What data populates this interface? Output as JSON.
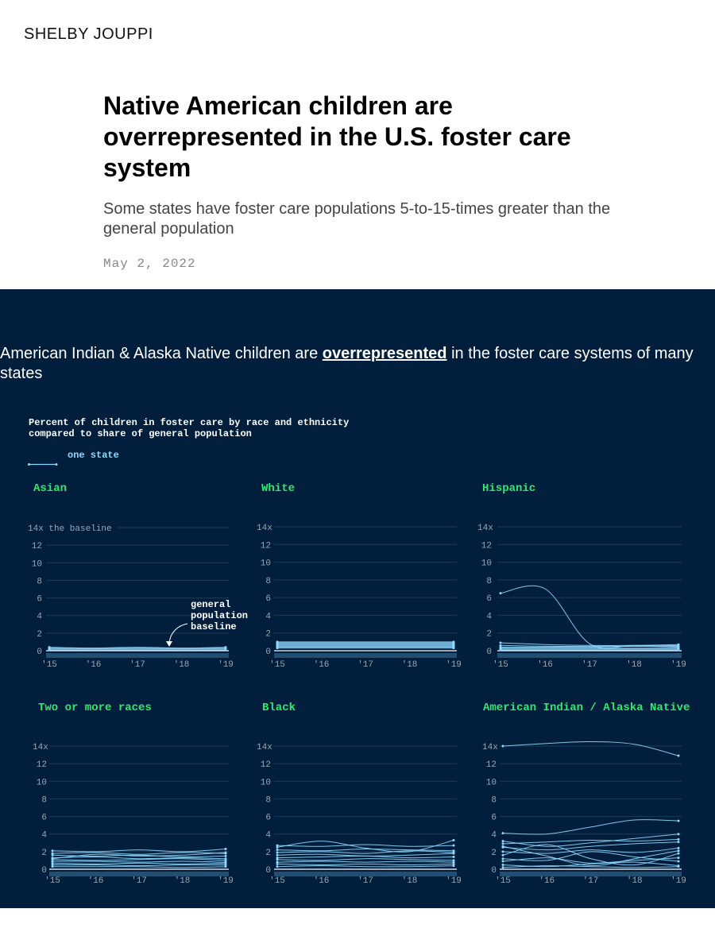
{
  "site": {
    "name": "SHELBY JOUPPI"
  },
  "article": {
    "title": "Native American children are overrepresented in the U.S. foster care system",
    "subtitle": "Some states have foster care populations 5-to-15-times greater than the general population",
    "date": "May 2, 2022"
  },
  "section": {
    "headline_pre": "American Indian & Alaska Native children are ",
    "headline_highlight": "overrepresented",
    "headline_post": " in the foster care systems of many states",
    "chart_title_1": "Percent of children in foster care by race and ethnicity",
    "chart_title_2": "compared to share of general population",
    "legend_label": "one state",
    "annotation": [
      "general",
      "population",
      "baseline"
    ]
  },
  "colors": {
    "background": "#011e3c",
    "line": "#8fd9ff",
    "panel_title": "#2ee86f",
    "grid": "#1e3a59",
    "tick": "#9aa7b5"
  },
  "chart_data": [
    {
      "type": "line",
      "title": "Asian",
      "x": [
        "'15",
        "'16",
        "'17",
        "'18",
        "'19"
      ],
      "yticks": [
        0,
        2,
        4,
        6,
        8,
        10,
        12,
        14
      ],
      "top_tick_label": "14x the baseline",
      "ylim": [
        0,
        14
      ],
      "series": [
        {
          "values": [
            0.3,
            0.3,
            0.3,
            0.3,
            0.3
          ]
        },
        {
          "values": [
            0.2,
            0.2,
            0.2,
            0.2,
            0.2
          ]
        },
        {
          "values": [
            0.1,
            0.1,
            0.1,
            0.1,
            0.1
          ]
        },
        {
          "values": [
            0.4,
            0.3,
            0.4,
            0.3,
            0.4
          ]
        }
      ]
    },
    {
      "type": "line",
      "title": "White",
      "x": [
        "'15",
        "'16",
        "'17",
        "'18",
        "'19"
      ],
      "yticks": [
        0,
        2,
        4,
        6,
        8,
        10,
        12,
        14
      ],
      "top_tick_label": "14x",
      "ylim": [
        0,
        14
      ],
      "series": [
        {
          "values": [
            1.0,
            1.0,
            1.0,
            1.0,
            1.0
          ]
        },
        {
          "values": [
            0.9,
            0.9,
            0.9,
            0.9,
            0.9
          ]
        },
        {
          "values": [
            0.8,
            0.8,
            0.8,
            0.8,
            0.8
          ]
        },
        {
          "values": [
            0.7,
            0.7,
            0.7,
            0.7,
            0.7
          ]
        },
        {
          "values": [
            0.6,
            0.6,
            0.6,
            0.6,
            0.6
          ]
        },
        {
          "values": [
            0.5,
            0.5,
            0.5,
            0.5,
            0.5
          ]
        },
        {
          "values": [
            0.4,
            0.4,
            0.4,
            0.4,
            0.4
          ]
        },
        {
          "values": [
            0.3,
            0.3,
            0.3,
            0.3,
            0.3
          ]
        }
      ]
    },
    {
      "type": "line",
      "title": "Hispanic",
      "x": [
        "'15",
        "'16",
        "'17",
        "'18",
        "'19"
      ],
      "yticks": [
        0,
        2,
        4,
        6,
        8,
        10,
        12,
        14
      ],
      "top_tick_label": "14x",
      "ylim": [
        0,
        14
      ],
      "series": [
        {
          "values": [
            6.5,
            7.0,
            0.8,
            0.6,
            0.5
          ]
        },
        {
          "values": [
            0.9,
            0.7,
            0.6,
            0.6,
            0.7
          ]
        },
        {
          "values": [
            0.6,
            0.5,
            0.5,
            0.5,
            0.6
          ]
        },
        {
          "values": [
            0.4,
            0.4,
            0.4,
            0.5,
            0.4
          ]
        },
        {
          "values": [
            0.3,
            0.3,
            0.3,
            0.3,
            0.3
          ]
        },
        {
          "values": [
            0.2,
            0.2,
            0.2,
            0.2,
            0.2
          ]
        },
        {
          "values": [
            0.1,
            0.1,
            0.1,
            0.1,
            0.1
          ]
        }
      ]
    },
    {
      "type": "line",
      "title": "Two or more races",
      "x": [
        "'15",
        "'16",
        "'17",
        "'18",
        "'19"
      ],
      "yticks": [
        0,
        2,
        4,
        6,
        8,
        10,
        12,
        14
      ],
      "top_tick_label": "14x",
      "ylim": [
        0,
        14
      ],
      "series": [
        {
          "values": [
            2.1,
            2.0,
            2.2,
            2.0,
            2.3
          ]
        },
        {
          "values": [
            1.8,
            1.9,
            1.7,
            1.9,
            1.8
          ]
        },
        {
          "values": [
            1.6,
            1.5,
            1.6,
            1.4,
            1.5
          ]
        },
        {
          "values": [
            1.3,
            1.4,
            1.2,
            1.3,
            1.2
          ]
        },
        {
          "values": [
            1.1,
            1.0,
            1.1,
            1.2,
            1.0
          ]
        },
        {
          "values": [
            0.9,
            0.9,
            0.8,
            0.9,
            0.8
          ]
        },
        {
          "values": [
            0.7,
            0.6,
            0.7,
            0.6,
            0.7
          ]
        },
        {
          "values": [
            0.5,
            0.5,
            0.4,
            0.5,
            0.5
          ]
        },
        {
          "values": [
            0.3,
            0.3,
            0.3,
            0.2,
            0.3
          ]
        },
        {
          "values": [
            1.2,
            1.7,
            1.5,
            1.6,
            1.9
          ]
        }
      ]
    },
    {
      "type": "line",
      "title": "Black",
      "x": [
        "'15",
        "'16",
        "'17",
        "'18",
        "'19"
      ],
      "yticks": [
        0,
        2,
        4,
        6,
        8,
        10,
        12,
        14
      ],
      "top_tick_label": "14x",
      "ylim": [
        0,
        14
      ],
      "series": [
        {
          "values": [
            2.5,
            3.2,
            2.4,
            2.0,
            3.3
          ]
        },
        {
          "values": [
            2.7,
            2.6,
            2.8,
            2.6,
            2.7
          ]
        },
        {
          "values": [
            2.2,
            2.1,
            2.3,
            2.2,
            2.1
          ]
        },
        {
          "values": [
            1.9,
            2.0,
            1.8,
            2.1,
            1.9
          ]
        },
        {
          "values": [
            1.6,
            1.7,
            1.5,
            1.6,
            1.8
          ]
        },
        {
          "values": [
            1.3,
            1.4,
            1.5,
            1.3,
            1.4
          ]
        },
        {
          "values": [
            1.1,
            1.0,
            1.2,
            1.1,
            1.0
          ]
        },
        {
          "values": [
            0.8,
            0.9,
            0.8,
            0.9,
            0.8
          ]
        },
        {
          "values": [
            0.6,
            0.5,
            0.6,
            0.5,
            0.6
          ]
        },
        {
          "values": [
            0.3,
            0.4,
            0.3,
            0.3,
            0.4
          ]
        }
      ]
    },
    {
      "type": "line",
      "title": "American Indian / Alaska Native",
      "x": [
        "'15",
        "'16",
        "'17",
        "'18",
        "'19"
      ],
      "yticks": [
        0,
        2,
        4,
        6,
        8,
        10,
        12,
        14
      ],
      "top_tick_label": "14x",
      "ylim": [
        0,
        14
      ],
      "series": [
        {
          "values": [
            14.0,
            14.3,
            14.5,
            14.2,
            12.9
          ]
        },
        {
          "values": [
            4.1,
            4.0,
            4.8,
            5.6,
            5.5
          ]
        },
        {
          "values": [
            3.2,
            2.6,
            3.0,
            3.5,
            4.0
          ]
        },
        {
          "values": [
            2.9,
            3.1,
            3.3,
            3.2,
            3.4
          ]
        },
        {
          "values": [
            2.5,
            2.2,
            2.6,
            2.9,
            3.1
          ]
        },
        {
          "values": [
            2.0,
            1.8,
            2.2,
            1.9,
            2.4
          ]
        },
        {
          "values": [
            1.6,
            2.8,
            1.2,
            0.5,
            1.8
          ]
        },
        {
          "values": [
            1.2,
            1.0,
            2.0,
            1.4,
            0.9
          ]
        },
        {
          "values": [
            0.9,
            1.3,
            0.7,
            1.0,
            1.3
          ]
        },
        {
          "values": [
            0.5,
            0.3,
            0.6,
            0.8,
            0.4
          ]
        },
        {
          "values": [
            2.6,
            1.5,
            0.4,
            1.2,
            2.1
          ]
        },
        {
          "values": [
            0.2,
            0.4,
            0.3,
            0.2,
            0.3
          ]
        }
      ]
    }
  ]
}
